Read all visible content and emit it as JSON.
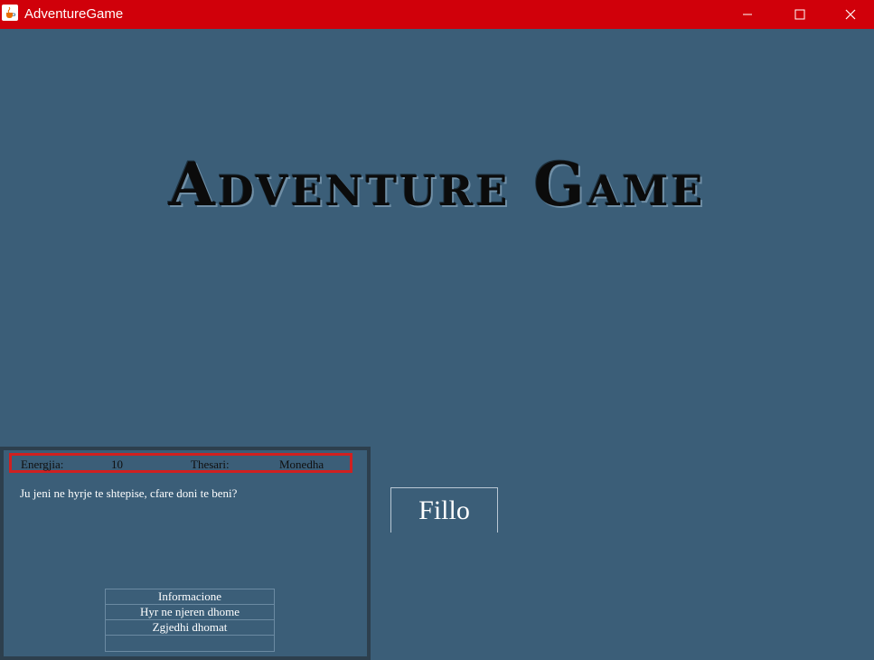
{
  "window": {
    "title": "AdventureGame",
    "app_icon": "java-cup-icon",
    "controls": [
      "minimize-icon",
      "maximize-icon",
      "close-icon"
    ]
  },
  "colors": {
    "titlebar": "#d0000a",
    "background": "#3b5e78",
    "stats_border": "#d02020"
  },
  "main": {
    "game_title": "Adventure Game",
    "start_label": "Fillo"
  },
  "panel": {
    "stats": {
      "energy_label": "Energjia:",
      "energy_value": "10",
      "treasure_label": "Thesari:",
      "treasure_value": "Monedha"
    },
    "message": "Ju jeni ne hyrje te shtepise, cfare doni te beni?",
    "menu": [
      "Informacione",
      "Hyr ne njeren dhome",
      "Zgjedhi dhomat",
      ""
    ]
  }
}
